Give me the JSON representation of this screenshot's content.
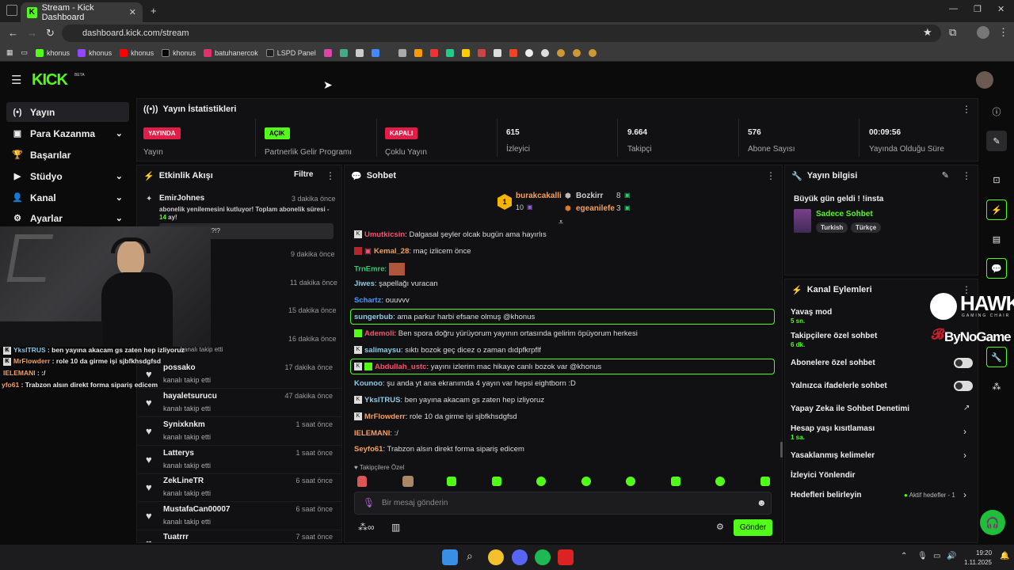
{
  "browser": {
    "tab_title": "Stream - Kick Dashboard",
    "tab_close": "✕",
    "new_tab": "+",
    "url": "dashboard.kick.com/stream",
    "bookmarks": [
      "khonus",
      "khonus",
      "khonus",
      "khonus",
      "batuhanercok",
      "LSPD Panel"
    ]
  },
  "header": {
    "logo": "KICK",
    "logo_beta": "BETA"
  },
  "sidebar": {
    "items": [
      {
        "icon": "(•)",
        "label": "Yayın"
      },
      {
        "icon": "▣",
        "label": "Para Kazanma"
      },
      {
        "icon": "🏆",
        "label": "Başarılar"
      },
      {
        "icon": "▶",
        "label": "Stüdyo"
      },
      {
        "icon": "👤",
        "label": "Kanal"
      },
      {
        "icon": "⚙",
        "label": "Ayarlar"
      }
    ]
  },
  "stats": {
    "title": "Yayın İstatistikleri",
    "items": [
      {
        "badge": "YAYINDA",
        "label": "Yayın",
        "color": "#e11d48"
      },
      {
        "badge": "AÇIK",
        "label": "Partnerlik Gelir Programı",
        "color": "#53fc18"
      },
      {
        "badge": "KAPALI",
        "label": "Çoklu Yayın",
        "color": "#e11d48"
      },
      {
        "value": "615",
        "label": "İzleyici"
      },
      {
        "value": "9.664",
        "label": "Takipçi"
      },
      {
        "value": "576",
        "label": "Abone Sayısı"
      },
      {
        "value": "00:09:56",
        "label": "Yayında Olduğu Süre"
      }
    ]
  },
  "activity": {
    "title": "Etkinlik Akışı",
    "filter": "Filtre",
    "first": {
      "name": "EmirJohnes",
      "time": "3 dakika önce",
      "text": "abonelik yenilemesini kutluyor! Toplam abonelik süresi -",
      "months": "14",
      "months_suffix": " ay!",
      "quote": "...nelerr oluyor?!?!?"
    },
    "times_hidden": [
      "9 dakika önce",
      "11 dakika önce",
      "15 dakika önce",
      "16 dakika önce"
    ],
    "partial_sub": "kanalı takip etti",
    "rows": [
      {
        "name": "possako",
        "sub": "kanalı takip etti",
        "time": "17 dakika önce"
      },
      {
        "name": "hayaletsurucu",
        "sub": "kanalı takip etti",
        "time": "47 dakika önce"
      },
      {
        "name": "Synixknkm",
        "sub": "kanalı takip etti",
        "time": "1 saat önce"
      },
      {
        "name": "Latterys",
        "sub": "kanalı takip etti",
        "time": "1 saat önce"
      },
      {
        "name": "ZekLineTR",
        "sub": "kanalı takip etti",
        "time": "6 saat önce"
      },
      {
        "name": "MustafaCan00007",
        "sub": "kanalı takip etti",
        "time": "6 saat önce"
      },
      {
        "name": "Tuatrrr",
        "sub": "",
        "time": "7 saat önce"
      }
    ]
  },
  "chat": {
    "title": "Sohbet",
    "leaders": {
      "first_name": "burakcakalli",
      "first_count": "10",
      "second_name": "Bozkirr",
      "second_count": "8",
      "third_name": "egeanilefe",
      "third_count": "3"
    },
    "messages": [
      {
        "user": "Umutkicsin",
        "color": "#ff4d6d",
        "text": "Dalgasal şeyler olcak bugün ama hayırlıs"
      },
      {
        "user": "Kemal_28",
        "color": "#f4a261",
        "text": "maç izlicem önce"
      },
      {
        "user": "TrnEmre",
        "color": "#2ecc71",
        "text": ""
      },
      {
        "user": "Jiwes",
        "color": "#8ecae6",
        "text": "şapellağı vuracan"
      },
      {
        "user": "Schartz",
        "color": "#4d96ff",
        "text": "ouuvvv"
      },
      {
        "user": "sungerbub",
        "color": "#8ecae6",
        "text": "ama parkur harbi efsane olmuş @khonus"
      },
      {
        "user": "Ademoli",
        "color": "#ff4d6d",
        "text": "Ben spora doğru yürüyorum yayının ortasında gelirim öpüyorum herkesi"
      },
      {
        "user": "salimaysu",
        "color": "#8ecae6",
        "text": "sıktı bozok geç dicez o zaman dıdpfkrpflf"
      },
      {
        "user": "Abdullah_ustc",
        "color": "#ff4d6d",
        "text": "yayını izlerim mac hikaye canlı bozok var @khonus"
      },
      {
        "user": "Kounoo",
        "color": "#8ecae6",
        "text": "şu anda yt ana ekranımda 4 yayın var hepsi eightborn :D"
      },
      {
        "user": "YkslTRUS",
        "color": "#8ecae6",
        "text": "ben yayına akacam gs zaten hep izliyoruz"
      },
      {
        "user": "MrFlowderr",
        "color": "#f4a261",
        "text": "role 10 da girme işi sjbfkhsdgfsd"
      },
      {
        "user": "IELEMANI",
        "color": "#f4a261",
        "text": ":/"
      },
      {
        "user": "Seyfo61",
        "color": "#f4a261",
        "text": "Trabzon alsın direkt forma sipariş edicem"
      }
    ],
    "followers_only": "Takipçilere Özel",
    "input_placeholder": "Bir mesaj gönderin",
    "send": "Gönder"
  },
  "stream_info": {
    "title": "Yayın bilgisi",
    "stream_title": "Büyük gün geldi ! !insta",
    "category": "Sadece Sohbet",
    "tags": [
      "Turkish",
      "Türkçe"
    ]
  },
  "channel_actions": {
    "title": "Kanal Eylemleri",
    "items": [
      {
        "label": "Yavaş mod",
        "sub": "5 sn."
      },
      {
        "label": "Takipçilere özel sohbet",
        "sub": "6 dk."
      },
      {
        "label": "Abonelere özel sohbet"
      },
      {
        "label": "Yalnızca ifadelerle sohbet"
      },
      {
        "label": "Yapay Zeka ile Sohbet Denetimi"
      },
      {
        "label": "Hesap yaşı kısıtlaması",
        "sub": "1 sa."
      },
      {
        "label": "Yasaklanmış kelimeler"
      },
      {
        "label": "İzleyici Yönlendir"
      },
      {
        "label": "Hedefleri belirleyin",
        "badge": "Aktif hedefler - 1"
      }
    ]
  },
  "overlay": {
    "lines": [
      {
        "user": "YkslTRUS",
        "text": " : ben yayına akacam gs zaten hep izliyoruz",
        "color": "#8ecae6"
      },
      {
        "user": "MrFlowderr",
        "text": " : role 10 da girme işi sjbfkhsdgfsd",
        "color": "#f4a261"
      },
      {
        "user": "IELEMANI",
        "text": " : :/",
        "color": "#f4a261"
      },
      {
        "user": "yfo61",
        "text": " : Trabzon alsın direkt forma sipariş edicem",
        "color": "#f4a261"
      }
    ],
    "sponsor1": "HAWK",
    "sponsor1_sub": "GAMING CHAIR",
    "sponsor2": "ByNoGame"
  },
  "taskbar": {
    "time": "19:20",
    "date": "1.11.2025"
  }
}
